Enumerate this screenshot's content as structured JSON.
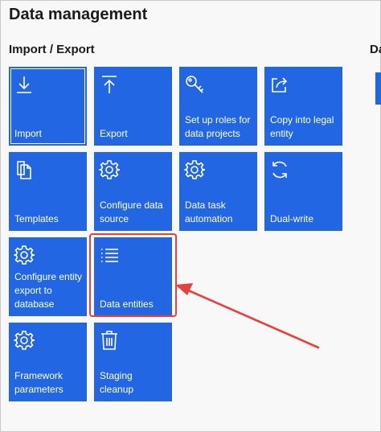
{
  "page": {
    "title": "Data management",
    "section_title": "Import / Export",
    "section_title_2": "Da"
  },
  "tiles": [
    {
      "label": "Import",
      "icon": "download-icon"
    },
    {
      "label": "Export",
      "icon": "upload-icon"
    },
    {
      "label": "Set up roles for data projects",
      "icon": "key-icon"
    },
    {
      "label": "Copy into legal entity",
      "icon": "share-icon"
    },
    {
      "label": "Templates",
      "icon": "copy-icon"
    },
    {
      "label": "Configure data source",
      "icon": "gear-icon"
    },
    {
      "label": "Data task automation",
      "icon": "gear-icon"
    },
    {
      "label": "Dual-write",
      "icon": "sync-icon"
    },
    {
      "label": "Configure entity export to database",
      "icon": "gear-icon"
    },
    {
      "label": "Data entities",
      "icon": "list-icon"
    },
    {
      "label": "Framework parameters",
      "icon": "gear-icon"
    },
    {
      "label": "Staging cleanup",
      "icon": "trash-icon"
    }
  ],
  "colors": {
    "tile": "#2266e3",
    "annotation": "#e8403e"
  }
}
